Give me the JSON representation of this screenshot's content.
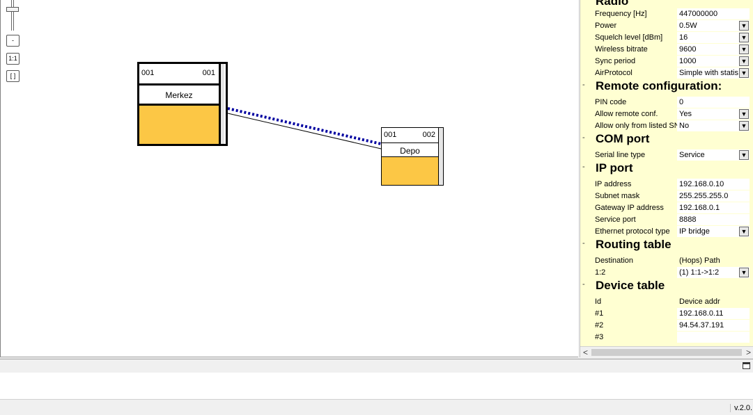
{
  "canvas": {
    "zoom_minus_label": "-",
    "zoom_one_label": "1:1",
    "zoom_fit_label": "[ ]",
    "nodes": [
      {
        "id": "merkez",
        "left_code": "001",
        "right_code": "001",
        "name": "Merkez",
        "body_color": "#fcc745"
      },
      {
        "id": "depo",
        "left_code": "001",
        "right_code": "002",
        "name": "Depo",
        "body_color": "#fcc745"
      }
    ],
    "link_color": "#0000a0"
  },
  "panel": {
    "radio": {
      "title": "Radio",
      "rows": [
        {
          "label": "Frequency [Hz]",
          "value": "447000000",
          "dropdown": false
        },
        {
          "label": "Power",
          "value": "0.5W",
          "dropdown": true
        },
        {
          "label": "Squelch level [dBm]",
          "value": "16",
          "dropdown": true
        },
        {
          "label": "Wireless bitrate",
          "value": "9600",
          "dropdown": true
        },
        {
          "label": "Sync period",
          "value": "1000",
          "dropdown": true
        },
        {
          "label": "AirProtocol",
          "value": "Simple with statis",
          "dropdown": true
        }
      ]
    },
    "remote": {
      "title": "Remote configuration:",
      "rows": [
        {
          "label": "PIN code",
          "value": "0",
          "dropdown": false
        },
        {
          "label": "Allow remote conf.",
          "value": "Yes",
          "dropdown": true
        },
        {
          "label": "Allow only from listed SN",
          "value": "No",
          "dropdown": true
        }
      ]
    },
    "com": {
      "title": "COM port",
      "rows": [
        {
          "label": "Serial line type",
          "value": "Service",
          "dropdown": true
        }
      ]
    },
    "ip": {
      "title": "IP port",
      "rows": [
        {
          "label": "IP address",
          "value": "192.168.0.10",
          "dropdown": false
        },
        {
          "label": "Subnet mask",
          "value": "255.255.255.0",
          "dropdown": false
        },
        {
          "label": "Gateway IP address",
          "value": "192.168.0.1",
          "dropdown": false
        },
        {
          "label": "Service port",
          "value": "8888",
          "dropdown": false
        },
        {
          "label": "Ethernet protocol type",
          "value": "IP bridge",
          "dropdown": true
        }
      ]
    },
    "routing": {
      "title": "Routing table",
      "header": {
        "label": "Destination",
        "value": "(Hops) Path"
      },
      "rows": [
        {
          "label": "1:2",
          "value": "(1) 1:1->1:2",
          "dropdown": true
        }
      ]
    },
    "device": {
      "title": "Device table",
      "header": {
        "label": "Id",
        "value": "Device addr"
      },
      "rows": [
        {
          "label": "#1",
          "value": "192.168.0.11",
          "dropdown": false
        },
        {
          "label": "#2",
          "value": "94.54.37.191",
          "dropdown": false
        },
        {
          "label": "#3",
          "value": "",
          "dropdown": false
        }
      ]
    },
    "collapse_symbol": "-",
    "dropdown_icon": "▼",
    "scroll_left": "<",
    "scroll_right": ">"
  },
  "status": {
    "version": "v.2.0."
  }
}
